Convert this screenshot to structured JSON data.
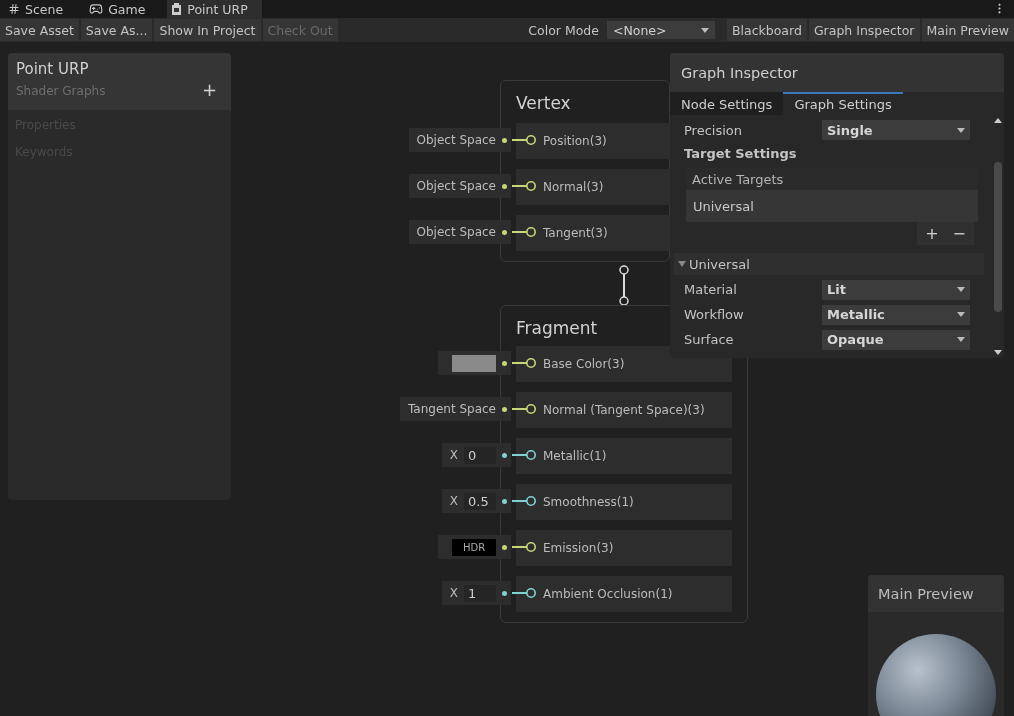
{
  "tabs": [
    {
      "label": "Scene",
      "selected": false
    },
    {
      "label": "Game",
      "selected": false
    },
    {
      "label": "Point URP",
      "selected": true
    }
  ],
  "toolbar": {
    "buttons": [
      {
        "label": "Save Asset",
        "disabled": false
      },
      {
        "label": "Save As...",
        "disabled": false
      },
      {
        "label": "Show In Project",
        "disabled": false
      },
      {
        "label": "Check Out",
        "disabled": true
      }
    ],
    "color_mode": {
      "label": "Color Mode",
      "value": "<None>"
    },
    "panel_toggles": [
      {
        "label": "Blackboard"
      },
      {
        "label": "Graph Inspector"
      },
      {
        "label": "Main Preview"
      }
    ]
  },
  "blackboard": {
    "title": "Point URP",
    "subtitle": "Shader Graphs",
    "add": "+",
    "sections": [
      "Properties",
      "Keywords"
    ]
  },
  "nodes": [
    {
      "title": "Vertex",
      "slots": [
        {
          "label": "Position(3)",
          "color": "#c8d676",
          "input": {
            "kind": "space",
            "text": "Object Space"
          }
        },
        {
          "label": "Normal(3)",
          "color": "#c8d676",
          "input": {
            "kind": "space",
            "text": "Object Space"
          }
        },
        {
          "label": "Tangent(3)",
          "color": "#c8d676",
          "input": {
            "kind": "space",
            "text": "Object Space"
          }
        }
      ]
    },
    {
      "title": "Fragment",
      "slots": [
        {
          "label": "Base Color(3)",
          "color": "#c8d676",
          "input": {
            "kind": "color",
            "color": "#8a8a8a"
          }
        },
        {
          "label": "Normal (Tangent Space)(3)",
          "color": "#c8d676",
          "input": {
            "kind": "space",
            "text": "Tangent Space"
          }
        },
        {
          "label": "Metallic(1)",
          "color": "#80d2d2",
          "input": {
            "kind": "float",
            "axis": "X",
            "value": "0"
          }
        },
        {
          "label": "Smoothness(1)",
          "color": "#80d2d2",
          "input": {
            "kind": "float",
            "axis": "X",
            "value": "0.5"
          }
        },
        {
          "label": "Emission(3)",
          "color": "#c8d676",
          "input": {
            "kind": "hdr",
            "text": "HDR"
          }
        },
        {
          "label": "Ambient Occlusion(1)",
          "color": "#80d2d2",
          "input": {
            "kind": "float",
            "axis": "X",
            "value": "1"
          }
        }
      ]
    }
  ],
  "inspector": {
    "title": "Graph Inspector",
    "tabs": [
      {
        "label": "Node Settings",
        "selected": false
      },
      {
        "label": "Graph Settings",
        "selected": true
      }
    ],
    "precision": {
      "label": "Precision",
      "value": "Single"
    },
    "target_settings": "Target Settings",
    "active_targets": {
      "header": "Active Targets",
      "items": [
        "Universal"
      ],
      "buttons": [
        "+",
        "−"
      ]
    },
    "foldout": {
      "label": "Universal",
      "expanded": true,
      "rows": [
        {
          "label": "Material",
          "value": "Lit"
        },
        {
          "label": "Workflow",
          "value": "Metallic"
        },
        {
          "label": "Surface",
          "value": "Opaque"
        }
      ]
    }
  },
  "main_preview": {
    "title": "Main Preview"
  }
}
